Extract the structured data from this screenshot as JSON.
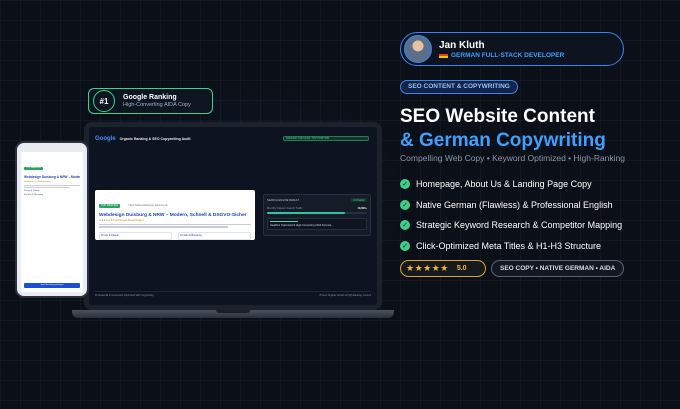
{
  "ranking": {
    "number": "#1",
    "title": "Google Ranking",
    "subtitle": "High-Converting AIDA Copy"
  },
  "laptop": {
    "logo": "Google",
    "title": "Organic Ranking & SEO Copywriting Audit",
    "pill": "RANKING SUCCESS: TOP POSITION",
    "serp": {
      "tag": "TOP RANKING",
      "url": "https://www.webdesign-duisburg.de",
      "title": "Webdesign Duisburg & NRW – Modern, Schnell & DSGVO-Sicher",
      "meta": "★★★★★ 5.0 (24 Google Bewertungen)",
      "box1": "Preise & Pakete",
      "box2": "Kontakt & Beratung"
    },
    "score": {
      "label": "SEARCH ENGINE RESULT",
      "pill": "#1 Position",
      "row_label": "Monthly Organic Search Traffic",
      "row_value": "10,000+",
      "sub_text": "Headline Optimized & High-Converting AIDA Formula"
    },
    "footer_left": "Professional & Conversion-Optimized SEO Copywriting",
    "footer_right": "Proven Organic Growth & High-Ranking Content"
  },
  "phone": {
    "tag": "TOP RANKING",
    "title": "Webdesign Duisburg & NRW – Modern & Sicher",
    "meta": "★★★★★ 5.0 Bewertungen",
    "link1": "Preise & Pakete",
    "link2": "Kontakt & Beratung",
    "button": "Jetzt Beratung anfragen"
  },
  "profile": {
    "name": "Jan Kluth",
    "role": "GERMAN FULL-STACK DEVELOPER"
  },
  "category": "SEO CONTENT & COPYWRITING",
  "headline": {
    "line1": "SEO Website Content",
    "line2": "& German Copywriting"
  },
  "tagline": "Compelling Web Copy • Keyword Optimized • High-Ranking",
  "features": [
    "Homepage, About Us & Landing Page Copy",
    "Native German (Flawless) & Professional English",
    "Strategic Keyword Research & Competitor Mapping",
    "Click-Optimized Meta Titles & H1-H3 Structure"
  ],
  "rating": {
    "stars": "★★★★★",
    "value": "5.0"
  },
  "feature_pill": "SEO COPY • NATIVE GERMAN • AIDA",
  "colors": {
    "accent": "#3fa0ff",
    "green": "#3ed08a",
    "gold": "#f2b931",
    "background": "#0b0f17"
  }
}
